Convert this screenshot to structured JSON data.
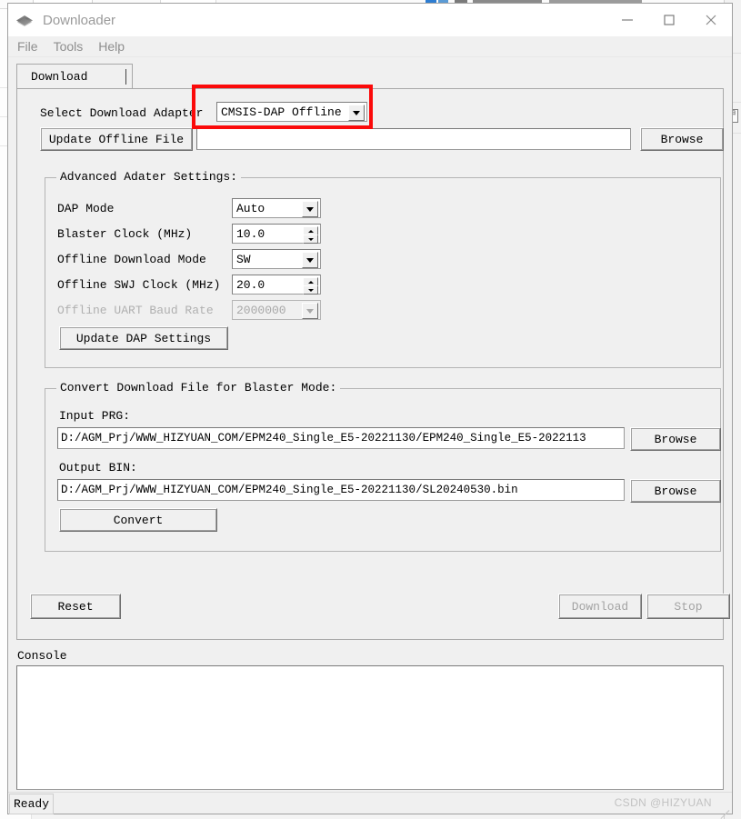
{
  "window": {
    "title": "Downloader",
    "icon": "app-diamond-icon",
    "controls": {
      "minimize": "minimize-icon",
      "maximize": "maximize-icon",
      "close": "close-icon"
    }
  },
  "menubar": {
    "items": [
      "File",
      "Tools",
      "Help"
    ]
  },
  "tabs": [
    {
      "label": "Download",
      "selected": true
    }
  ],
  "adapter": {
    "label": "Select Download Adapter",
    "selected": "CMSIS-DAP Offline",
    "highlighted": true,
    "highlight_color": "#fb0a0a"
  },
  "offline_file": {
    "button_label": "Update Offline File",
    "value": "",
    "placeholder": "",
    "browse_label": "Browse"
  },
  "advanced": {
    "title": "Advanced Adater Settings:",
    "fields": [
      {
        "label": "DAP Mode",
        "type": "combo",
        "value": "Auto",
        "disabled": false
      },
      {
        "label": "Blaster Clock (MHz)",
        "type": "spin",
        "value": "10.0",
        "disabled": false
      },
      {
        "label": "Offline Download Mode",
        "type": "combo",
        "value": "SW",
        "disabled": false
      },
      {
        "label": "Offline SWJ Clock (MHz)",
        "type": "spin",
        "value": "20.0",
        "disabled": false
      },
      {
        "label": "Offline UART Baud Rate",
        "type": "combo",
        "value": "2000000",
        "disabled": true
      }
    ],
    "update_button": "Update DAP Settings"
  },
  "convert": {
    "title": "Convert Download File for Blaster Mode:",
    "input_label": "Input PRG:",
    "input_value": "D:/AGM_Prj/WWW_HIZYUAN_COM/EPM240_Single_E5-20221130/EPM240_Single_E5-2022113",
    "input_browse": "Browse",
    "output_label": "Output BIN:",
    "output_value": "D:/AGM_Prj/WWW_HIZYUAN_COM/EPM240_Single_E5-20221130/SL20240530.bin",
    "output_browse": "Browse",
    "convert_button": "Convert"
  },
  "actions": {
    "reset": "Reset",
    "download": "Download",
    "download_disabled": true,
    "stop": "Stop",
    "stop_disabled": true
  },
  "console": {
    "label": "Console",
    "text": ""
  },
  "statusbar": {
    "status": "Ready",
    "watermark": "CSDN @HIZYUAN"
  }
}
